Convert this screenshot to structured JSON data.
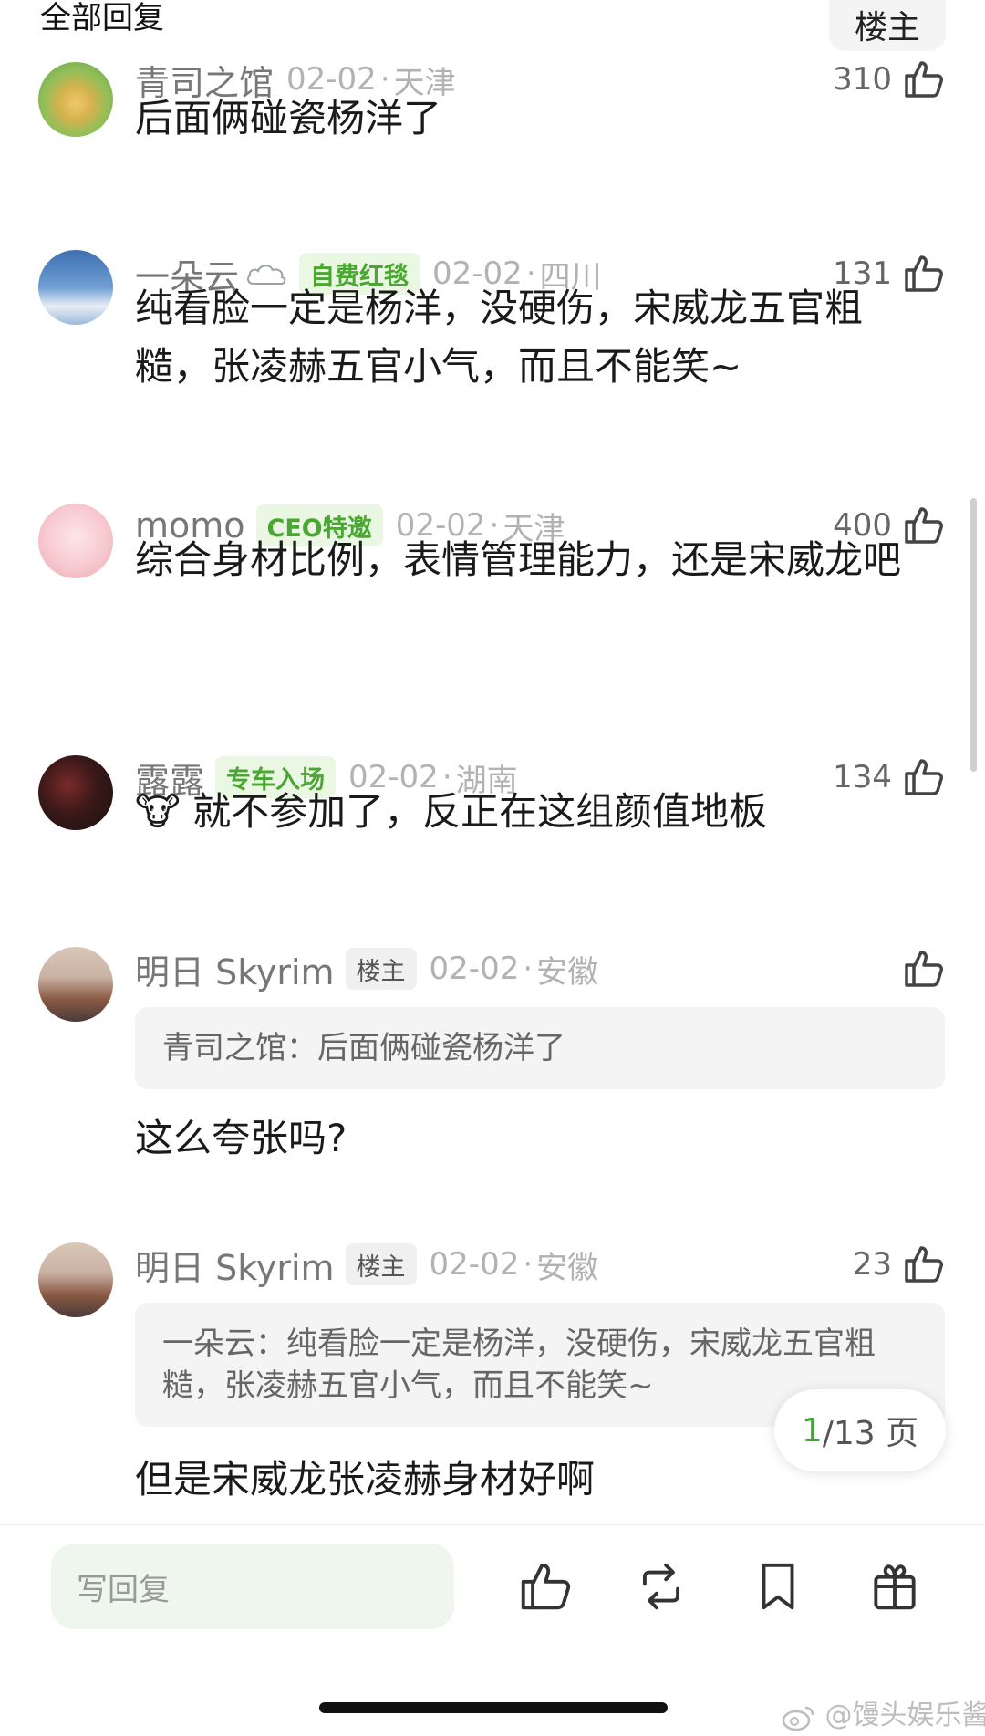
{
  "header": {
    "title": "全部回复",
    "op_filter": "楼主"
  },
  "comments": [
    {
      "user": "青司之馆",
      "date": "02-02",
      "location": "天津",
      "likes": "310",
      "text": "后面俩碰瓷杨洋了"
    },
    {
      "user": "一朵云",
      "badge": "自费红毯",
      "date": "02-02",
      "location": "四川",
      "likes": "131",
      "text": "纯看脸一定是杨洋，没硬伤，宋威龙五官粗糙，张凌赫五官小气，而且不能笑~"
    },
    {
      "user": "momo",
      "badge": "CEO特邀",
      "date": "02-02",
      "location": "天津",
      "likes": "400",
      "text": "综合身材比例，表情管理能力，还是宋威龙吧"
    },
    {
      "user": "露露",
      "badge": "专车入场",
      "date": "02-02",
      "location": "湖南",
      "likes": "134",
      "emoji": "🐮",
      "text": "就不参加了，反正在这组颜值地板"
    },
    {
      "user": "明日 Skyrim",
      "badge": "楼主",
      "date": "02-02",
      "location": "安徽",
      "likes": "",
      "quote": "青司之馆：后面俩碰瓷杨洋了",
      "text": "这么夸张吗?"
    },
    {
      "user": "明日 Skyrim",
      "badge": "楼主",
      "date": "02-02",
      "location": "安徽",
      "likes": "23",
      "quote": "一朵云：纯看脸一定是杨洋，没硬伤，宋威龙五官粗糙，张凌赫五官小气，而且不能笑~",
      "text": "但是宋威龙张凌赫身材好啊"
    }
  ],
  "pagination": {
    "current": "1",
    "total": "/13 页"
  },
  "composer": {
    "placeholder": "写回复"
  },
  "icons": [
    "thumbs-up-icon",
    "repost-icon",
    "bookmark-icon",
    "gift-icon",
    "cloud-icon",
    "weibo-icon"
  ],
  "watermark": "@馒头娱乐酱",
  "colors": {
    "accent_green": "#4aa832",
    "badge_bg": "#eaf7e3",
    "composer_bg": "#eef6ee"
  }
}
